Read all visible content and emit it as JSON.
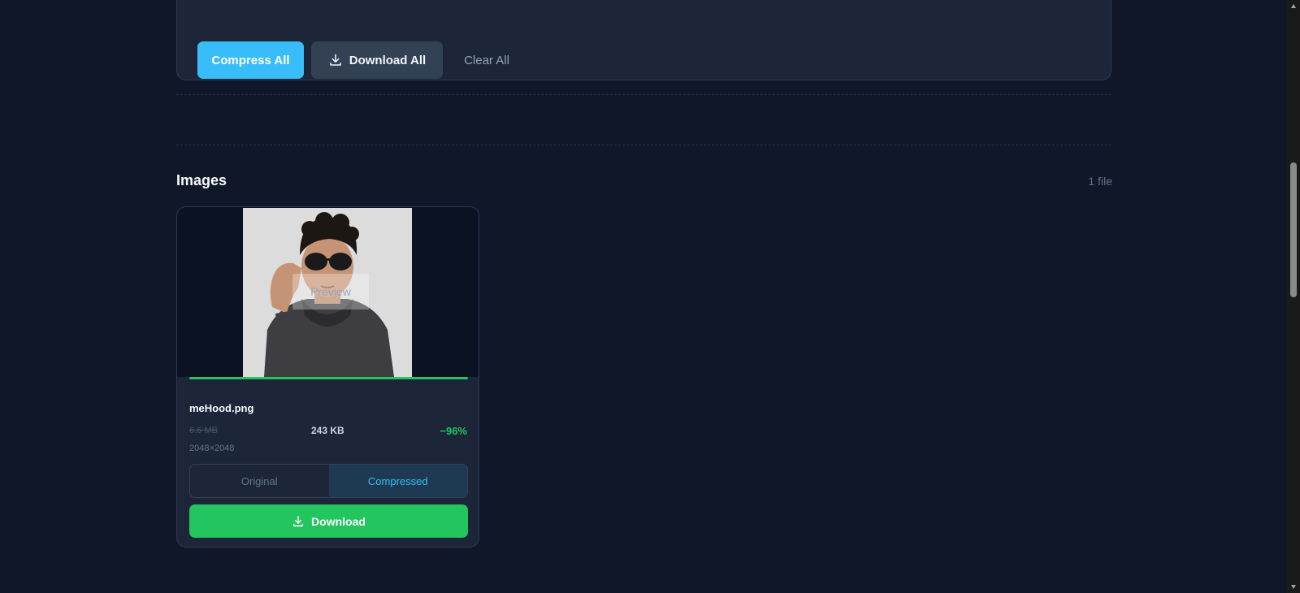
{
  "toolbar": {
    "compress_all_label": "Compress All",
    "download_all_label": "Download All",
    "clear_all_label": "Clear All"
  },
  "images_section": {
    "title": "Images",
    "file_count": "1 file"
  },
  "image_card": {
    "preview_label": "Preview",
    "progress": 1.0,
    "file_name": "meHood.png",
    "original_size": "6.6 MB",
    "compressed_size": "243 KB",
    "savings": "−96%",
    "dimensions": "2048×2048",
    "view_toggle": {
      "options": [
        "Original",
        "Compressed"
      ],
      "selected": "Compressed"
    },
    "download_label": "Download"
  },
  "icons": [
    "download-icon",
    "scroll-up-arrow-icon",
    "scroll-down-arrow-icon"
  ],
  "colors": {
    "background": "#0f1729",
    "panel": "#1c2638",
    "accent": "#38bdf8",
    "success": "#22c55e"
  }
}
